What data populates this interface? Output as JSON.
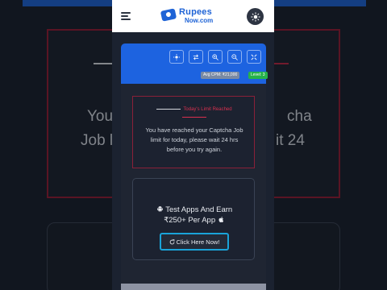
{
  "header": {
    "logo_line1": "Rupees",
    "logo_line2": "Now.com"
  },
  "toolbar": {
    "icons": [
      "sun-icon",
      "arrows-icon",
      "zoom-in-icon",
      "zoom-out-icon",
      "expand-icon"
    ]
  },
  "stats": {
    "cpm_label": "Avg CPM: ₹21,000",
    "level_label": "Level: 3"
  },
  "alert": {
    "title": "Today's Limit Reached",
    "message": "You have reached your Captcha Job limit for today, please wait 24 hrs before you try again."
  },
  "promo": {
    "title_line1": "Test Apps And Earn",
    "title_line2": "₹250+ Per App",
    "button_label": "Click Here Now!"
  },
  "background": {
    "text_left_1": "You",
    "text_right_1": "cha",
    "text_left_2": "Job l",
    "text_right_2": "it 24"
  },
  "colors": {
    "brand": "#1e63d6",
    "alert": "#d9304f",
    "success": "#26b24a",
    "button_border": "#1aa3d9"
  }
}
